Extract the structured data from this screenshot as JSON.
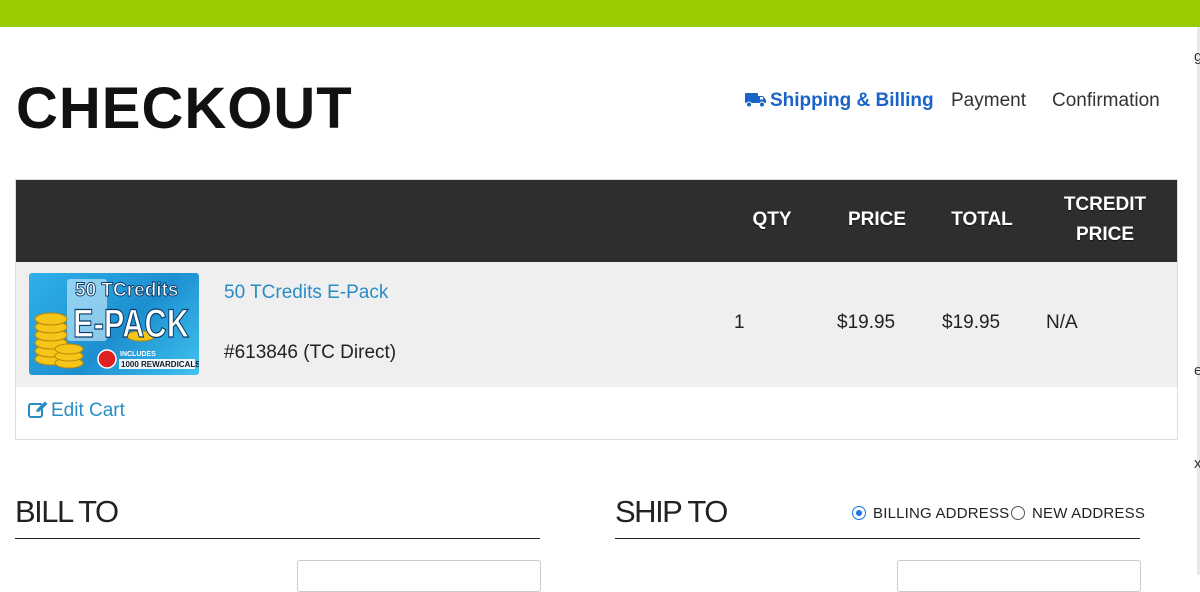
{
  "page": {
    "title": "CHECKOUT",
    "accent_color": "#99cc00",
    "link_color": "#2a8cc4",
    "active_step_color": "#1a63c8"
  },
  "steps": [
    {
      "label": "Shipping & Billing",
      "icon": "truck-icon",
      "active": true
    },
    {
      "label": "Payment",
      "active": false
    },
    {
      "label": "Confirmation",
      "active": false
    }
  ],
  "cart": {
    "columns": {
      "qty": "QTY",
      "price": "PRICE",
      "total": "TOTAL",
      "tcredit_line1": "TCREDIT",
      "tcredit_line2": "PRICE"
    },
    "items": [
      {
        "name": "50 TCredits E-Pack",
        "sku": "#613846 (TC Direct)",
        "qty": "1",
        "price": "$19.95",
        "total": "$19.95",
        "tcredit_price": "N/A",
        "image": {
          "line1": "50 TCredits",
          "line2": "E-PACK",
          "badge_line1": "INCLUDES",
          "badge_line2": "1000 REWARDICALS!"
        }
      }
    ],
    "edit_label": "Edit Cart"
  },
  "bill_to": {
    "title": "BILL TO"
  },
  "ship_to": {
    "title": "SHIP TO",
    "options": [
      {
        "label": "BILLING ADDRESS",
        "checked": true
      },
      {
        "label": "NEW ADDRESS",
        "checked": false
      }
    ]
  },
  "edge_chars": [
    "g",
    "e",
    "x"
  ]
}
